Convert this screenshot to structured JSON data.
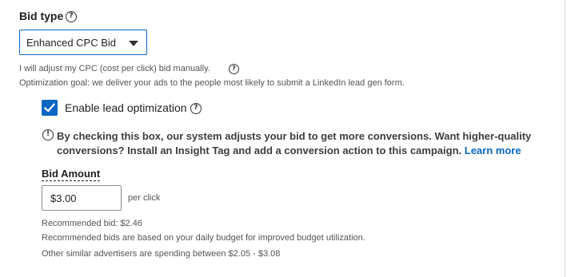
{
  "bid_type": {
    "label": "Bid type",
    "help_glyph": "?",
    "selected_option": "Enhanced CPC Bid",
    "manual_text": "I will adjust my CPC (cost per click) bid manually.",
    "optimization_goal_text": "Optimization goal: we deliver your ads to the people most likely to submit a LinkedIn lead gen form."
  },
  "lead_optimization": {
    "checked": true,
    "label": "Enable lead optimization",
    "info_glyph": "!",
    "info_line_1": "By checking this box, our system adjusts your bid to get more conversions. Want higher-quality",
    "info_line_2": "conversions? Install an Insight Tag and add a conversion action to this campaign.",
    "learn_more": "Learn more"
  },
  "bid_amount": {
    "label": "Bid Amount",
    "value": "$3.00",
    "unit": "per click",
    "recommended": "Recommended bid: $2.46",
    "recommended_note": "Recommended bids are based on your daily budget for improved budget utilization.",
    "similar_advertisers": "Other similar advertisers are spending between $2.05 - $3.08"
  },
  "colors": {
    "accent": "#0a66c2",
    "text_primary": "#1f1f1f",
    "text_secondary": "#545454"
  },
  "icons": {
    "help": "question-circle-icon",
    "caret": "caret-down-icon",
    "check": "checkmark-icon",
    "info": "exclamation-circle-icon"
  }
}
